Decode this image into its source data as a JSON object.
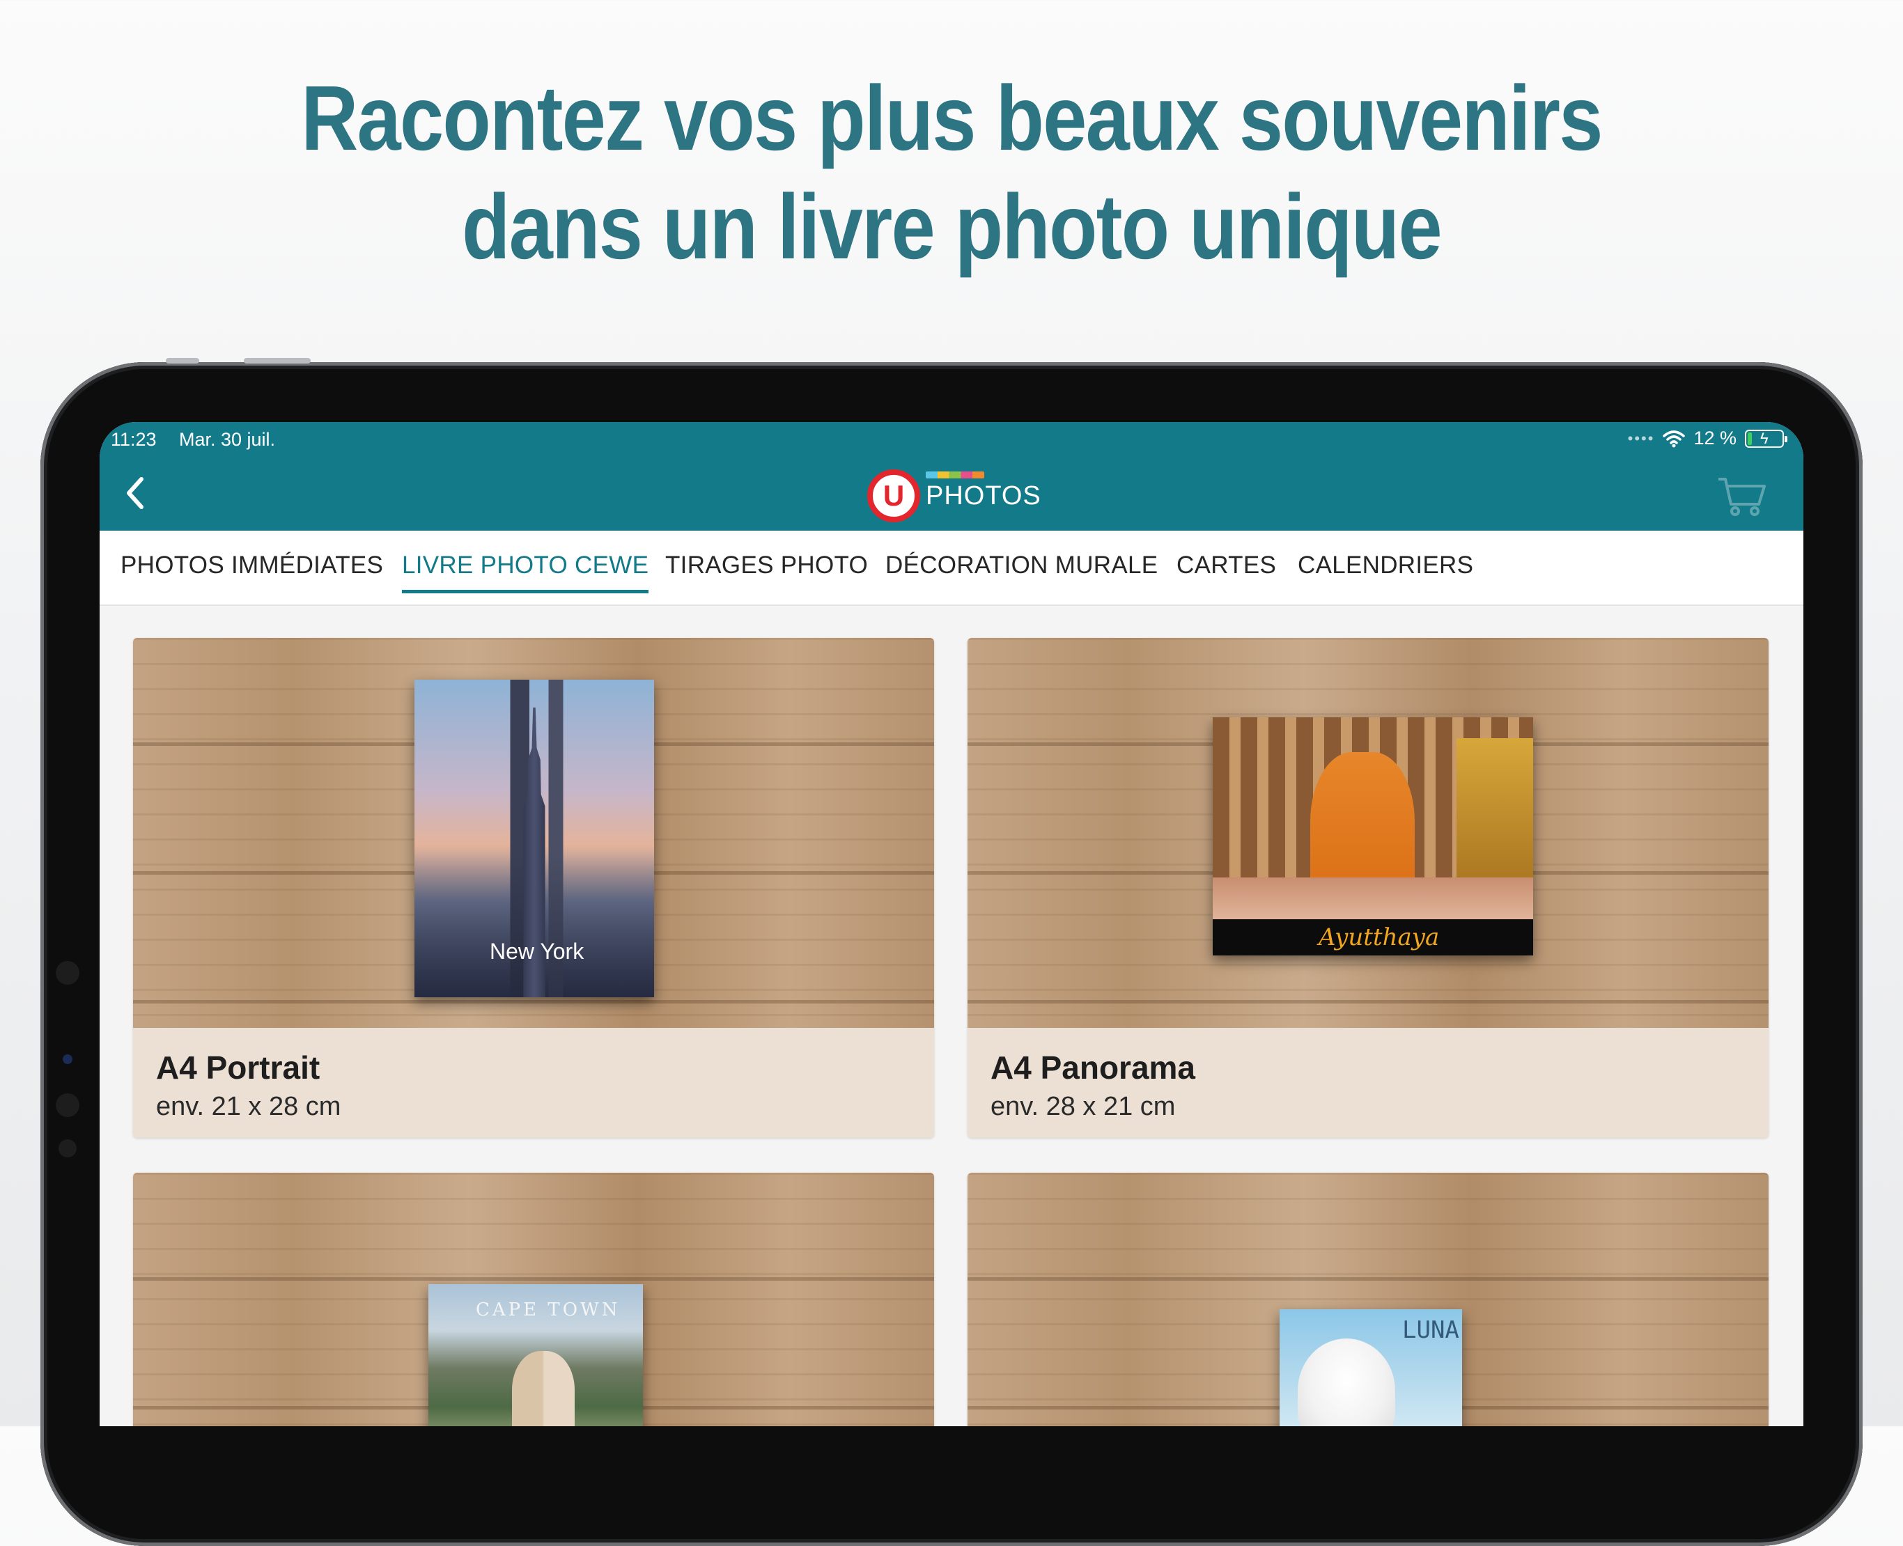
{
  "headline": {
    "line1": "Racontez vos plus beaux souvenirs",
    "line2": "dans un livre photo unique"
  },
  "status_bar": {
    "time": "11:23",
    "date": "Mar. 30 juil.",
    "battery_percent": "12 %",
    "icons": [
      "cellular-dots-icon",
      "wifi-icon",
      "battery-charging-icon"
    ]
  },
  "nav": {
    "back_icon": "chevron-left-icon",
    "logo_letter": "U",
    "logo_text": "PHOTOS",
    "cart_icon": "cart-icon"
  },
  "tabs": [
    {
      "label": "PHOTOS IMMÉDIATES",
      "active": false
    },
    {
      "label": "LIVRE PHOTO CEWE",
      "active": true
    },
    {
      "label": "TIRAGES PHOTO",
      "active": false
    },
    {
      "label": "DÉCORATION MURALE",
      "active": false
    },
    {
      "label": "CARTES",
      "active": false
    },
    {
      "label": "CALENDRIERS",
      "active": false
    }
  ],
  "products": [
    {
      "name": "A4 Portrait",
      "dims": "env. 21 x 28 cm",
      "cover_text": "New York"
    },
    {
      "name": "A4 Panorama",
      "dims": "env. 28 x 21 cm",
      "cover_text": "Ayutthaya"
    },
    {
      "name": "",
      "dims": "",
      "cover_text": "CAPE TOWN"
    },
    {
      "name": "",
      "dims": "",
      "cover_text": "LUNA"
    }
  ],
  "colors": {
    "brand_teal": "#137a8a",
    "headline_teal": "#2e7584",
    "logo_red": "#e3262e",
    "card_footer": "#ece0d4"
  }
}
